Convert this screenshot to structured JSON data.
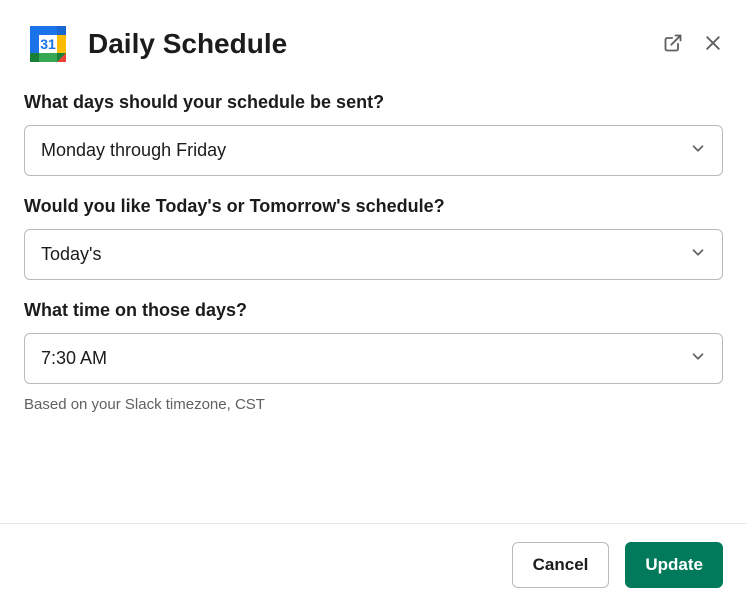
{
  "header": {
    "title": "Daily Schedule",
    "icon_day": "31"
  },
  "form": {
    "days": {
      "label": "What days should your schedule be sent?",
      "value": "Monday through Friday"
    },
    "which_schedule": {
      "label": "Would you like Today's or Tomorrow's schedule?",
      "value": "Today's"
    },
    "time": {
      "label": "What time on those days?",
      "value": "7:30 AM",
      "hint": "Based on your Slack timezone, CST"
    }
  },
  "footer": {
    "cancel_label": "Cancel",
    "submit_label": "Update"
  }
}
